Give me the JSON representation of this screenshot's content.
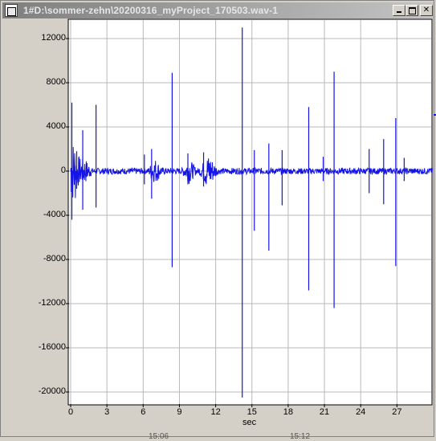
{
  "window": {
    "title": "1#D:\\sommer-zehn\\20200316_myProject_170503.wav-1"
  },
  "title_buttons": {
    "minimize_icon": "minimize-icon",
    "maximize_icon": "maximize-icon",
    "close_icon": "close-icon"
  },
  "colors": {
    "waveform": "#1414e6",
    "grid": "#b8b8b8",
    "titlebar_start": "#7f7f7f",
    "titlebar_end": "#c4c4c4"
  },
  "chart_data": {
    "type": "line",
    "xlabel": "sec",
    "ylabel": "",
    "xlim": [
      0,
      30
    ],
    "ylim": [
      -21000,
      14500
    ],
    "x_ticks": [
      "0",
      "3",
      "6",
      "9",
      "12",
      "15",
      "18",
      "21",
      "24",
      "27"
    ],
    "y_ticks": [
      "12000",
      "8000",
      "4000",
      "0",
      "-4000",
      "-8000",
      "-12000",
      "-16000",
      "-20000"
    ],
    "grid": true,
    "spikes": [
      {
        "t": 0.1,
        "max": 6200,
        "min": -4400
      },
      {
        "t": 0.5,
        "max": 1800,
        "min": -1600
      },
      {
        "t": 1.0,
        "max": 3700,
        "min": -3500
      },
      {
        "t": 2.1,
        "max": 6000,
        "min": -3300
      },
      {
        "t": 6.1,
        "max": 1500,
        "min": -1200
      },
      {
        "t": 6.7,
        "max": 2000,
        "min": -2500
      },
      {
        "t": 8.4,
        "max": 8900,
        "min": -8700
      },
      {
        "t": 9.7,
        "max": 1600,
        "min": -1200
      },
      {
        "t": 11.0,
        "max": 1700,
        "min": -1400
      },
      {
        "t": 14.2,
        "max": 13000,
        "min": -20500
      },
      {
        "t": 15.2,
        "max": 1900,
        "min": -5400
      },
      {
        "t": 16.4,
        "max": 2500,
        "min": -7200
      },
      {
        "t": 17.5,
        "max": 1900,
        "min": -3100
      },
      {
        "t": 19.7,
        "max": 5800,
        "min": -10800
      },
      {
        "t": 20.9,
        "max": 1300,
        "min": -900
      },
      {
        "t": 21.8,
        "max": 9000,
        "min": -12400
      },
      {
        "t": 24.7,
        "max": 2000,
        "min": -2000
      },
      {
        "t": 25.9,
        "max": 2900,
        "min": -3000
      },
      {
        "t": 26.9,
        "max": 4800,
        "min": -8600
      },
      {
        "t": 27.6,
        "max": 1200,
        "min": -900
      }
    ]
  },
  "bottom_axis": {
    "labels": [
      "15:06",
      "15:12"
    ]
  }
}
